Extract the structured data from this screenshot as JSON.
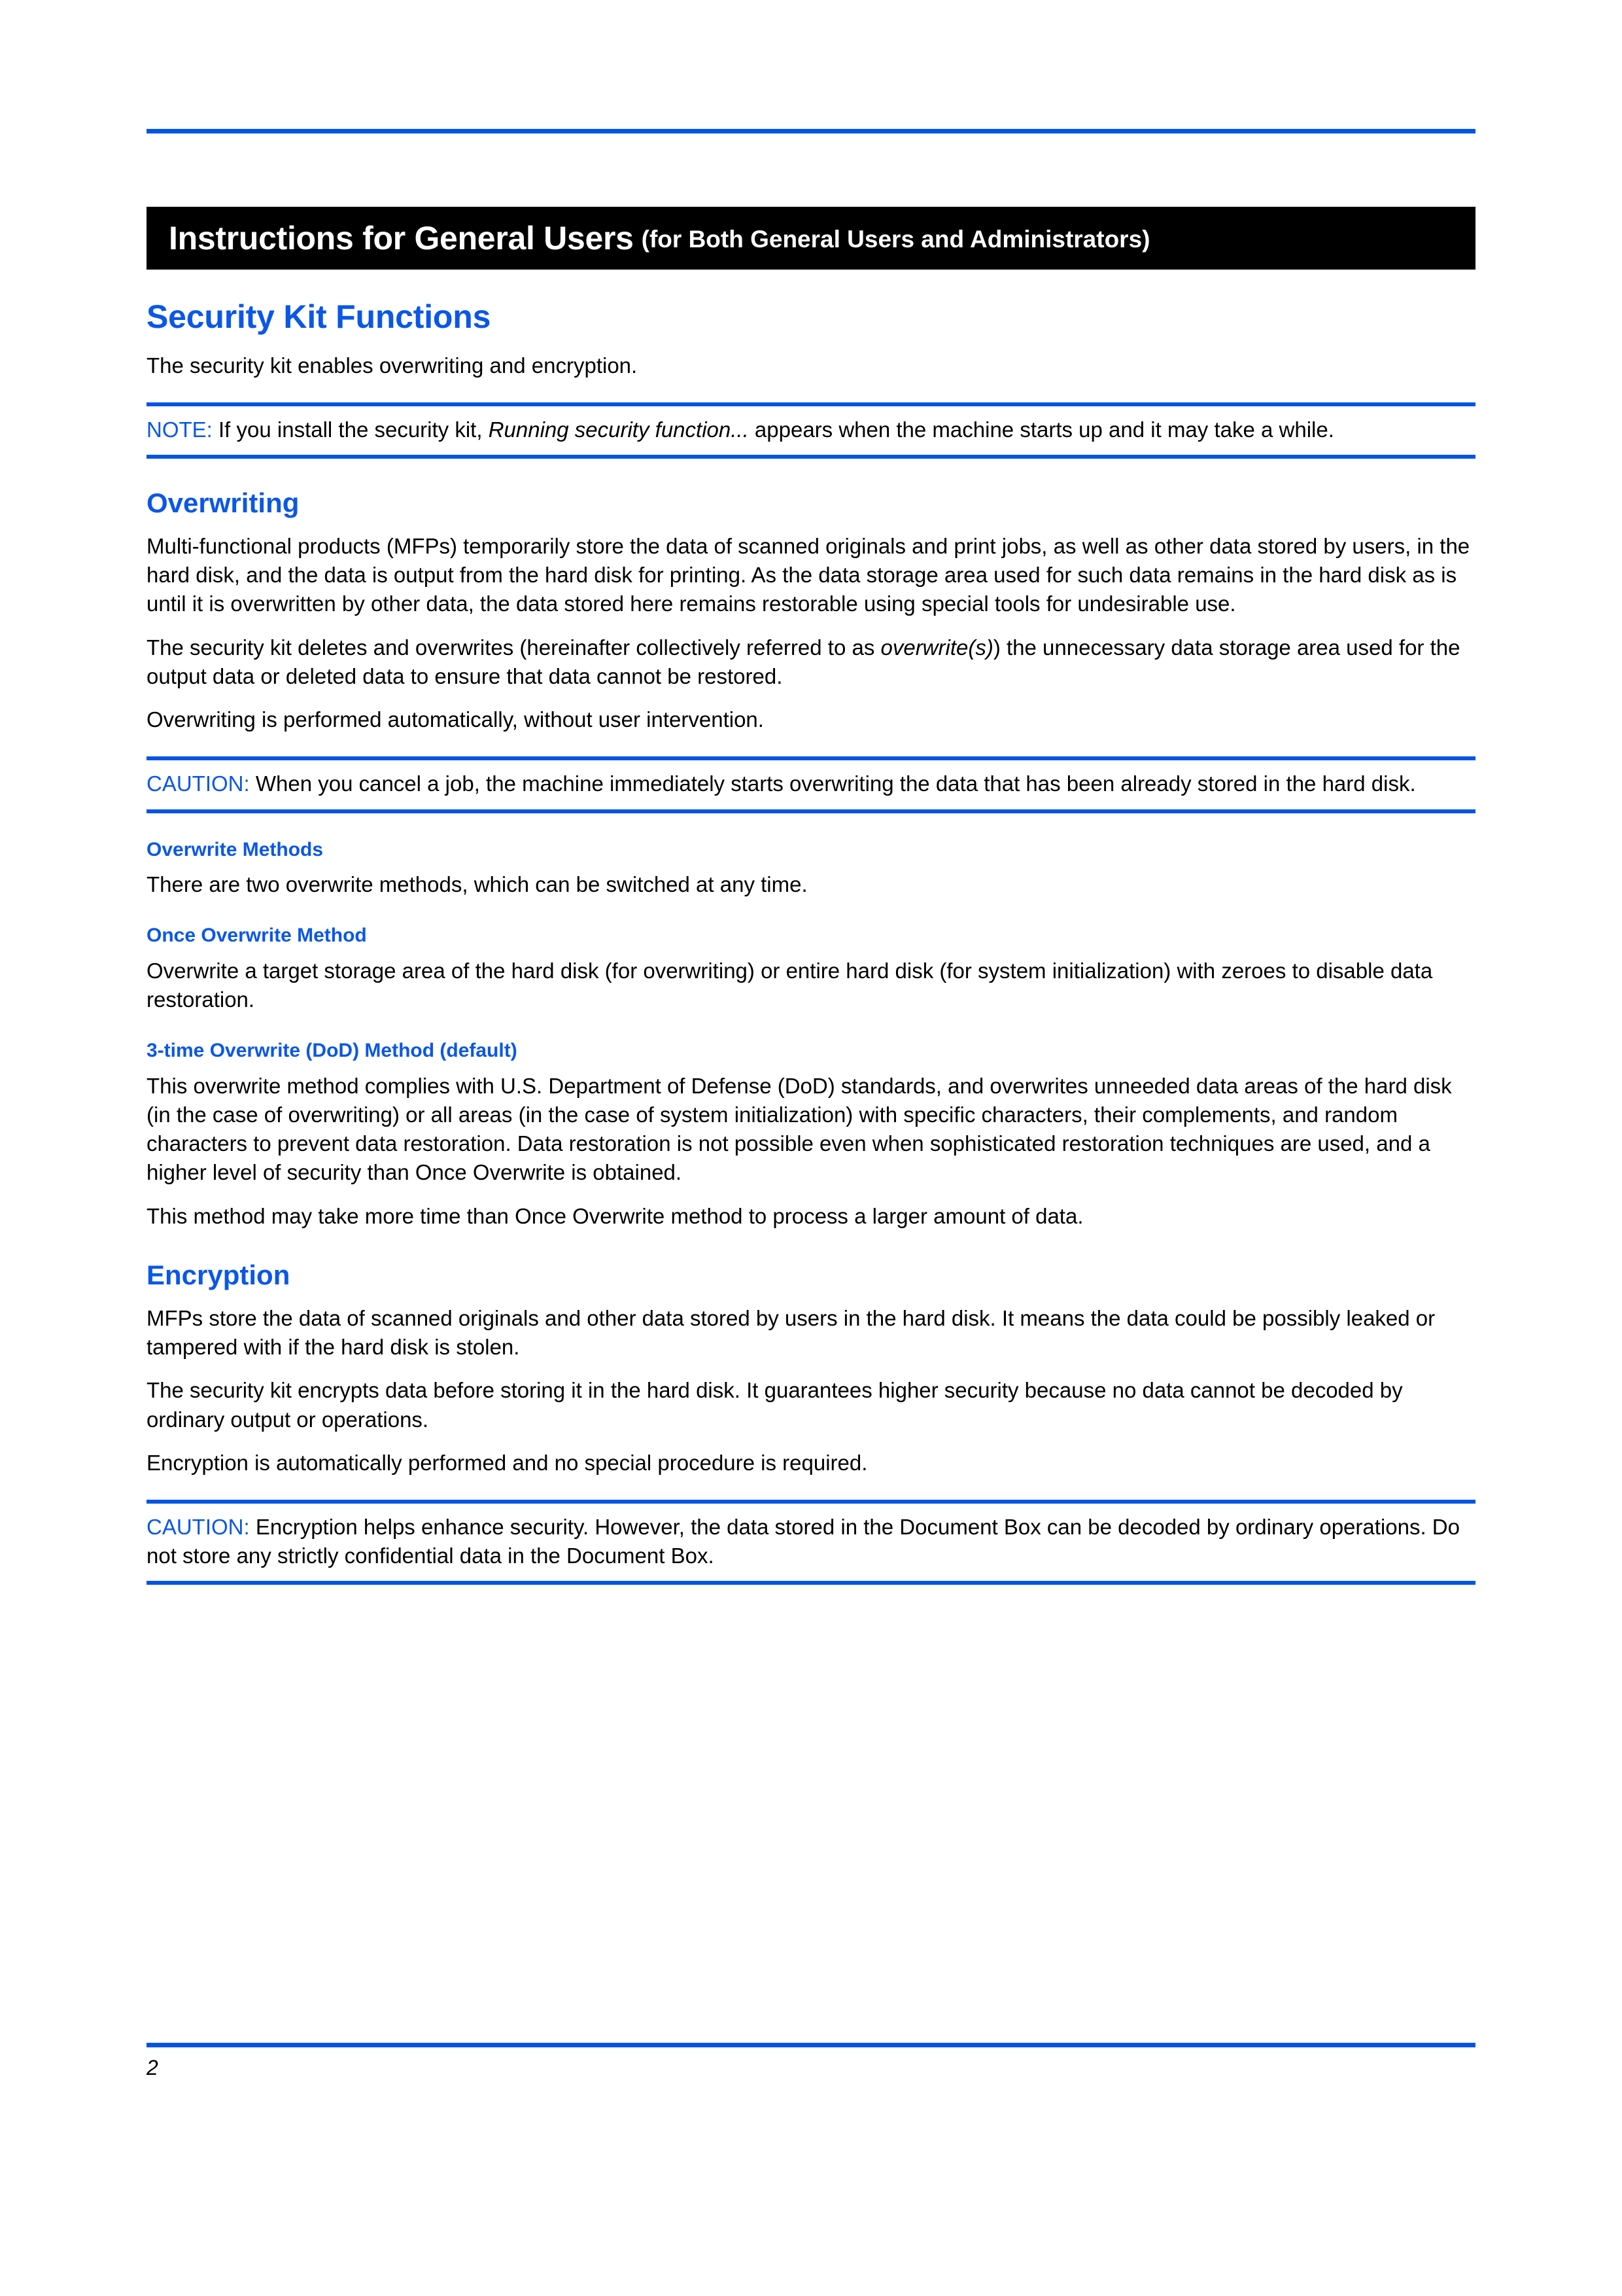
{
  "colors": {
    "accent_blue": "#0a57e8",
    "rule_blue": "#0055e5",
    "banner_bg": "#000000",
    "banner_text": "#ffffff",
    "body_text": "#000000"
  },
  "banner": {
    "title": "Instructions for General Users",
    "subtitle": "(for Both General Users and Administrators)"
  },
  "sections": {
    "security_kit_functions": {
      "heading": "Security Kit Functions",
      "intro": "The security kit enables overwriting and encryption.",
      "note": {
        "label": "NOTE:",
        "text_before": " If you install the security kit, ",
        "italic": "Running security function...",
        "text_after": " appears when the machine starts up and it may take a while."
      }
    },
    "overwriting": {
      "heading": "Overwriting",
      "paragraphs": [
        "Multi-functional products (MFPs) temporarily store the data of scanned originals and print jobs, as well as other data stored by users, in the hard disk, and the data is output from the hard disk for printing. As the data storage area used for such data remains in the hard disk as is until it is overwritten by other data, the data stored here remains restorable using special tools for undesirable use."
      ],
      "paragraph_with_italic": {
        "text_before": "The security kit deletes and overwrites (hereinafter collectively referred to as ",
        "italic": "overwrite(s)",
        "text_after": ") the unnecessary data storage area used for the output data or deleted data to ensure that data cannot be restored."
      },
      "paragraph_after": "Overwriting is performed automatically, without user intervention.",
      "caution": {
        "label": "CAUTION:",
        "text": " When you cancel a job, the machine immediately starts overwriting the data that has been already stored in the hard disk."
      },
      "overwrite_methods": {
        "heading": "Overwrite Methods",
        "text": "There are two overwrite methods, which can be switched at any time."
      },
      "once_overwrite": {
        "heading": "Once Overwrite Method",
        "text": "Overwrite a target storage area of the hard disk (for overwriting) or entire hard disk (for system initialization) with zeroes to disable data restoration."
      },
      "dod_overwrite": {
        "heading": "3-time Overwrite (DoD) Method (default)",
        "paragraph1": "This overwrite method complies with U.S. Department of Defense (DoD) standards, and overwrites unneeded data areas of the hard disk (in the case of overwriting) or all areas (in the case of system initialization) with specific characters, their complements, and random characters to prevent data restoration. Data restoration is not possible even when sophisticated restoration techniques are used, and a higher level of security than Once Overwrite is obtained.",
        "paragraph2": "This method may take more time than Once Overwrite method to process a larger amount of data."
      }
    },
    "encryption": {
      "heading": "Encryption",
      "paragraphs": [
        "MFPs store the data of scanned originals and other data stored by users in the hard disk. It means the data could be possibly leaked or tampered with if the hard disk is stolen.",
        "The security kit encrypts data before storing it in the hard disk. It guarantees higher security because no data cannot be decoded by ordinary output or operations.",
        "Encryption is automatically performed and no special procedure is required."
      ],
      "caution": {
        "label": "CAUTION:",
        "text": " Encryption helps enhance security. However, the data stored in the Document Box can be decoded by ordinary operations. Do not store any strictly confidential data in the Document Box."
      }
    }
  },
  "footer": {
    "page_number": "2"
  }
}
